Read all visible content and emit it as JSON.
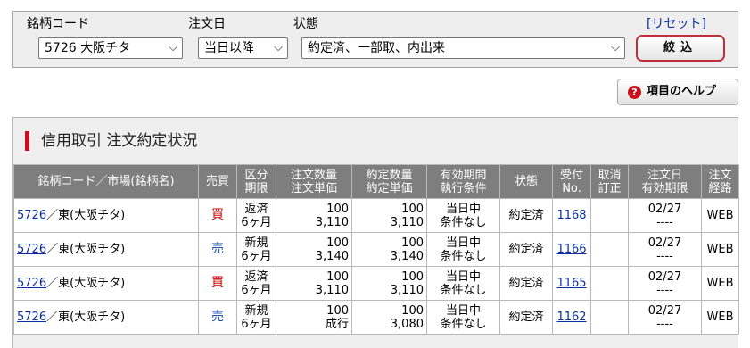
{
  "filters": {
    "symbol_label": "銘柄コード",
    "symbol_value": "5726 大阪チタ",
    "date_label": "注文日",
    "date_value": "当日以降",
    "status_label": "状態",
    "status_value": "約定済、一部取、内出来",
    "reset_label": "[リセット]",
    "filter_button": "絞込"
  },
  "help_button": "項目のヘルプ",
  "section_title": "信用取引 注文約定状況",
  "table": {
    "headers": {
      "symbol": "銘柄コード／市場(銘柄名)",
      "side": "売買",
      "kubun": [
        "区分",
        "期限"
      ],
      "order_qty": [
        "注文数量",
        "注文単価"
      ],
      "exec_qty": [
        "約定数量",
        "約定単価"
      ],
      "validity": [
        "有効期間",
        "執行条件"
      ],
      "status": "状態",
      "receipt": [
        "受付",
        "No."
      ],
      "cancel": [
        "取消",
        "訂正"
      ],
      "order_date": [
        "注文日",
        "有効期限"
      ],
      "route": [
        "注文",
        "経路"
      ]
    },
    "rows": [
      {
        "code": "5726",
        "market_name": "／東(大阪チタ)",
        "side": "買",
        "side_type": "buy",
        "kubun": "返済",
        "term": "6ヶ月",
        "order_qty": "100",
        "order_price": "3,110",
        "exec_qty": "100",
        "exec_price": "3,110",
        "validity": "当日中",
        "condition": "条件なし",
        "status": "約定済",
        "receipt": "1168",
        "order_date": "02/27",
        "expiry": "----",
        "route": "WEB"
      },
      {
        "code": "5726",
        "market_name": "／東(大阪チタ)",
        "side": "売",
        "side_type": "sell",
        "kubun": "新規",
        "term": "6ヶ月",
        "order_qty": "100",
        "order_price": "3,140",
        "exec_qty": "100",
        "exec_price": "3,140",
        "validity": "当日中",
        "condition": "条件なし",
        "status": "約定済",
        "receipt": "1166",
        "order_date": "02/27",
        "expiry": "----",
        "route": "WEB"
      },
      {
        "code": "5726",
        "market_name": "／東(大阪チタ)",
        "side": "買",
        "side_type": "buy",
        "kubun": "返済",
        "term": "6ヶ月",
        "order_qty": "100",
        "order_price": "3,110",
        "exec_qty": "100",
        "exec_price": "3,110",
        "validity": "当日中",
        "condition": "条件なし",
        "status": "約定済",
        "receipt": "1165",
        "order_date": "02/27",
        "expiry": "----",
        "route": "WEB"
      },
      {
        "code": "5726",
        "market_name": "／東(大阪チタ)",
        "side": "売",
        "side_type": "sell",
        "kubun": "新規",
        "term": "6ヶ月",
        "order_qty": "100",
        "order_price": "成行",
        "exec_qty": "100",
        "exec_price": "3,080",
        "validity": "当日中",
        "condition": "条件なし",
        "status": "約定済",
        "receipt": "1162",
        "order_date": "02/27",
        "expiry": "----",
        "route": "WEB"
      }
    ]
  },
  "colors": {
    "buy": "#d00000",
    "sell": "#1a4fb0",
    "header_bg": "#7e7e7e",
    "accent": "#c8101e"
  }
}
